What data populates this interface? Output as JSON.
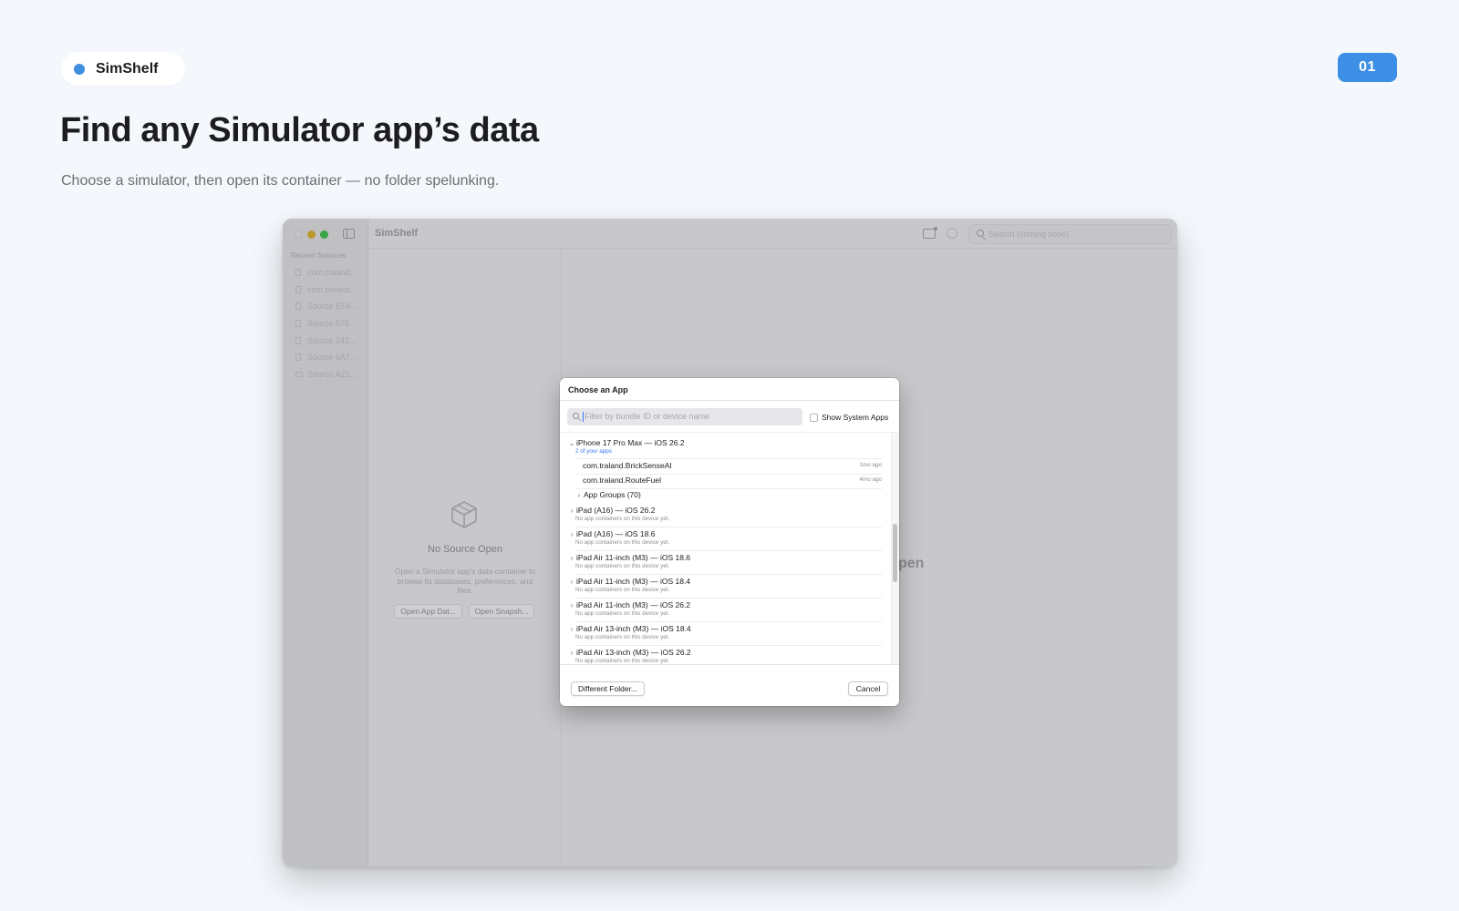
{
  "brand": {
    "name": "SimShelf",
    "accent": "#3f8ee0"
  },
  "step_badge": "01",
  "hero": {
    "title": "Find any Simulator app’s data",
    "subtitle": "Choose a simulator, then open its container — no folder spelunking."
  },
  "window": {
    "toolbar_title": "SimShelf",
    "search_placeholder": "Search (coming soon)",
    "sidebar": {
      "heading": "Recent Sources",
      "items": [
        {
          "label": "com.traland...",
          "icon": "document-icon"
        },
        {
          "label": "com.traland...",
          "icon": "document-icon"
        },
        {
          "label": "Source EFA...",
          "icon": "document-icon"
        },
        {
          "label": "Source 576...",
          "icon": "document-icon"
        },
        {
          "label": "Source 242...",
          "icon": "document-icon"
        },
        {
          "label": "Source 6A7...",
          "icon": "document-icon"
        },
        {
          "label": "Source A21...",
          "icon": "camera-icon"
        }
      ]
    },
    "empty_state": {
      "icon": "cube-icon",
      "title": "No Source Open",
      "description": "Open a Simulator app's data container to browse its databases, preferences, and files.",
      "open_app_data_label": "Open App Dat...",
      "open_snapshot_label": "Open Snapsh..."
    },
    "background_text_peek": "pen"
  },
  "dialog": {
    "title": "Choose an App",
    "filter_placeholder": "Filter by bundle ID or device name",
    "show_system_apps_label": "Show System Apps",
    "show_system_apps_checked": false,
    "expanded_device": {
      "name": "iPhone 17 Pro Max — iOS 26.2",
      "subtitle": "2 of your apps",
      "apps": [
        {
          "bundle_id": "com.traland.BrickSenseAI",
          "modified": "1mo ago"
        },
        {
          "bundle_id": "com.traland.RouteFuel",
          "modified": "4mo ago"
        }
      ],
      "app_groups_label": "App Groups (70)"
    },
    "collapsed_devices": [
      {
        "name": "iPad (A16) — iOS 26.2",
        "subtitle": "No app containers on this device yet."
      },
      {
        "name": "iPad (A16) — iOS 18.6",
        "subtitle": "No app containers on this device yet."
      },
      {
        "name": "iPad Air 11-inch (M3) — iOS 18.6",
        "subtitle": "No app containers on this device yet."
      },
      {
        "name": "iPad Air 11-inch (M3) — iOS 18.4",
        "subtitle": "No app containers on this device yet."
      },
      {
        "name": "iPad Air 11-inch (M3) — iOS 26.2",
        "subtitle": "No app containers on this device yet."
      },
      {
        "name": "iPad Air 13-inch (M3) — iOS 18.4",
        "subtitle": "No app containers on this device yet."
      },
      {
        "name": "iPad Air 13-inch (M3) — iOS 26.2",
        "subtitle": "No app containers on this device yet."
      }
    ],
    "different_folder_label": "Different Folder...",
    "cancel_label": "Cancel"
  }
}
